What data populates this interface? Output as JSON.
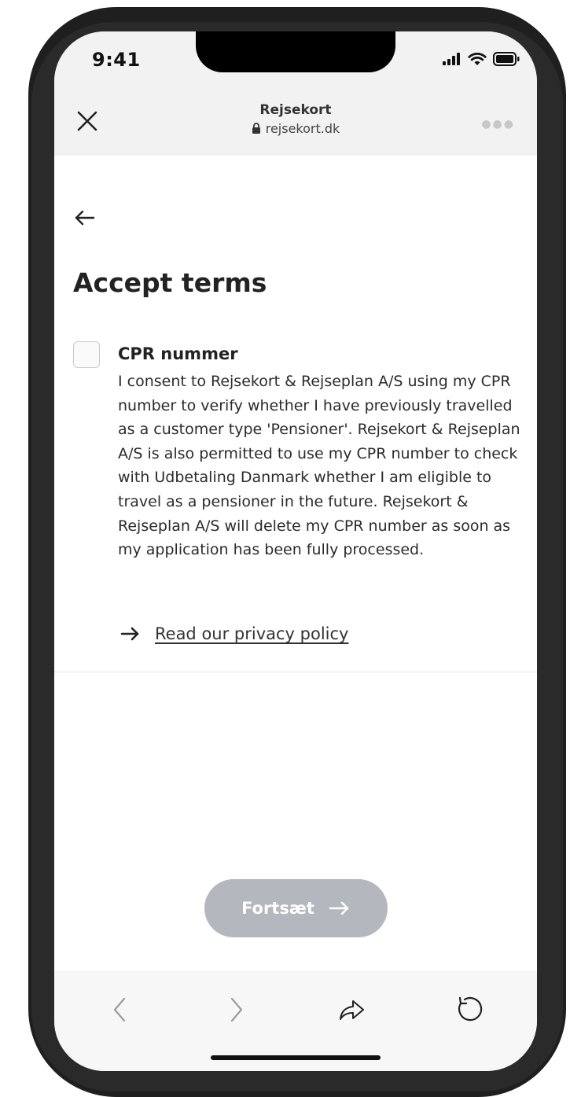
{
  "status_bar": {
    "time": "9:41",
    "icons": [
      "signal-icon",
      "wifi-icon",
      "battery-icon"
    ]
  },
  "browser": {
    "title": "Rejsekort",
    "url": "rejsekort.dk",
    "close_icon": "close-icon",
    "lock_icon": "lock-icon",
    "more_icon": "more-dots-icon"
  },
  "page": {
    "back_icon": "back-arrow-icon",
    "title": "Accept terms",
    "consent": {
      "checked": false,
      "title": "CPR nummer",
      "body": "I consent to Rejsekort & Rejseplan A/S using my CPR number to verify whether I have previously travelled as a customer type 'Pensioner'. Rejsekort & Rejseplan A/S is also permitted to use my CPR number to check with Udbetaling Danmark whether I am eligible to travel as a pensioner in the future. Rejsekort & Rejseplan A/S will delete my CPR number as soon as my application has been fully processed."
    },
    "privacy_link": {
      "label": "Read our privacy policy",
      "icon": "arrow-right-icon"
    },
    "continue_button": {
      "label": "Fortsæt",
      "icon": "arrow-right-icon",
      "disabled": true
    }
  },
  "bottom_nav": {
    "items": [
      "back-icon",
      "forward-icon",
      "share-icon",
      "reload-icon"
    ]
  },
  "colors": {
    "button_disabled_bg": "#b5b7bf",
    "browser_bar_bg": "#f2f2f2",
    "text_primary": "#222222"
  }
}
